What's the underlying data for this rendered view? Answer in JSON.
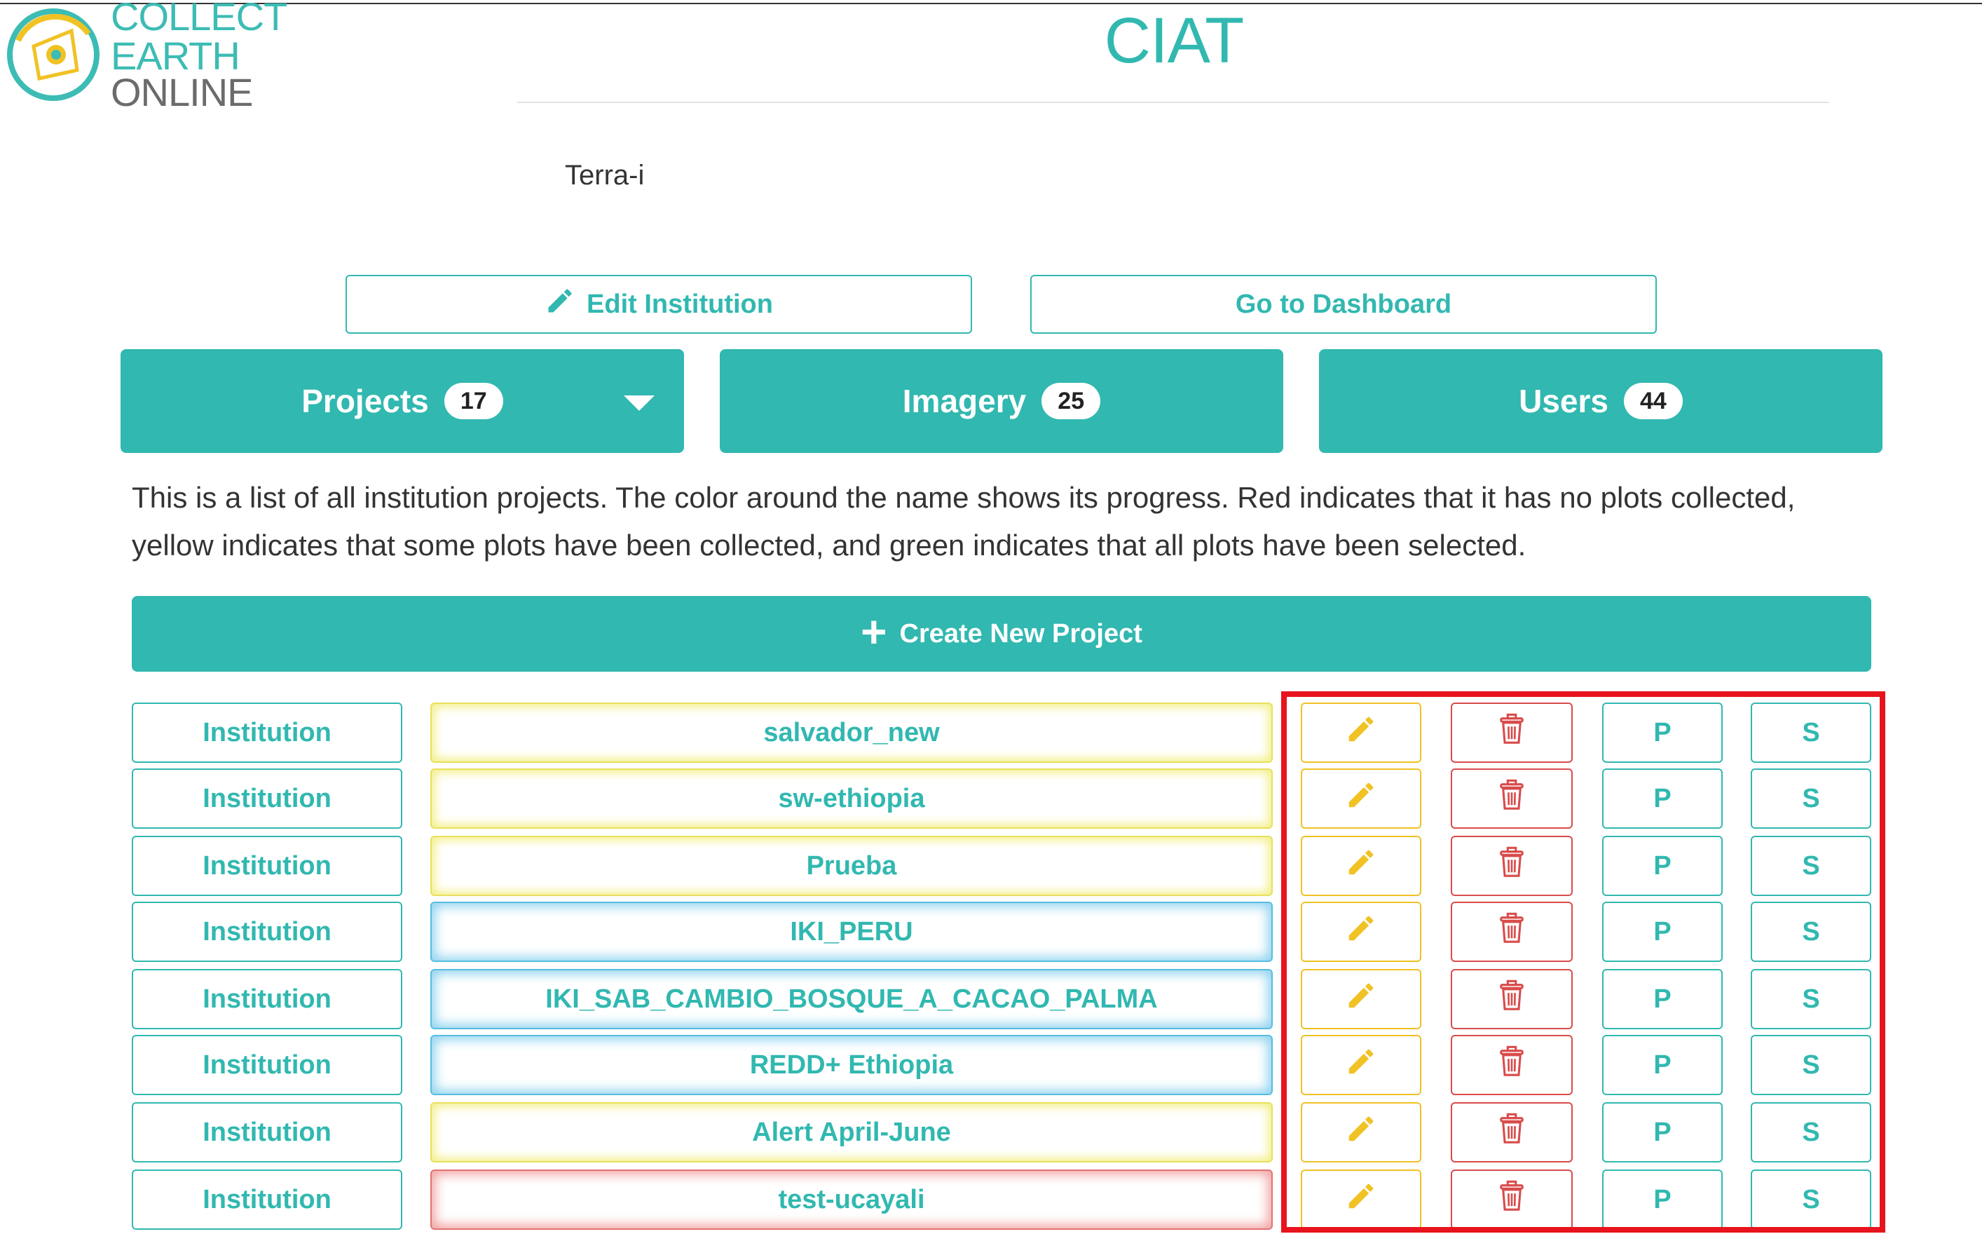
{
  "logo": {
    "line1": "COLLECT EARTH",
    "line2": "ONLINE"
  },
  "institution": {
    "title": "CIAT",
    "description": "Terra-i"
  },
  "actions": {
    "edit_label": "Edit Institution",
    "dashboard_label": "Go to Dashboard"
  },
  "tabs": [
    {
      "label": "Projects",
      "count": "17",
      "has_dropdown": true
    },
    {
      "label": "Imagery",
      "count": "25"
    },
    {
      "label": "Users",
      "count": "44"
    }
  ],
  "help_text": "This is a list of all institution projects. The color around the name shows its progress. Red indicates that it has no plots collected, yellow indicates that some plots have been collected, and green indicates that all plots have been selected.",
  "create_label": "Create New Project",
  "colors": {
    "accent": "#31b8b0",
    "edit": "#f0c224",
    "delete": "#d94b4b",
    "highlight": "#e8141d"
  },
  "projects": [
    {
      "institution": "Institution",
      "name": "salvador_new",
      "status": "yellow",
      "p": "P",
      "s": "S"
    },
    {
      "institution": "Institution",
      "name": "sw-ethiopia",
      "status": "yellow",
      "p": "P",
      "s": "S"
    },
    {
      "institution": "Institution",
      "name": "Prueba",
      "status": "yellow",
      "p": "P",
      "s": "S"
    },
    {
      "institution": "Institution",
      "name": "IKI_PERU",
      "status": "blue",
      "p": "P",
      "s": "S"
    },
    {
      "institution": "Institution",
      "name": "IKI_SAB_CAMBIO_BOSQUE_A_CACAO_PALMA",
      "status": "blue",
      "p": "P",
      "s": "S"
    },
    {
      "institution": "Institution",
      "name": "REDD+ Ethiopia",
      "status": "blue",
      "p": "P",
      "s": "S"
    },
    {
      "institution": "Institution",
      "name": "Alert April-June",
      "status": "yellow",
      "p": "P",
      "s": "S"
    },
    {
      "institution": "Institution",
      "name": "test-ucayali",
      "status": "red",
      "p": "P",
      "s": "S"
    }
  ]
}
